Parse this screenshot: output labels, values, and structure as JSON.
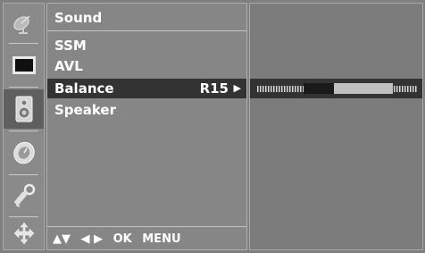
{
  "sidebar": {
    "icons": [
      {
        "name": "satellite-dish-icon",
        "active": false
      },
      {
        "name": "picture-icon",
        "active": false
      },
      {
        "name": "speaker-icon",
        "active": true
      },
      {
        "name": "clock-icon",
        "active": false
      },
      {
        "name": "key-icon",
        "active": false
      },
      {
        "name": "input-source-icon",
        "active": false
      }
    ]
  },
  "menu": {
    "title": "Sound",
    "items": [
      {
        "label": "SSM",
        "value": ""
      },
      {
        "label": "AVL",
        "value": ""
      },
      {
        "label": "Balance",
        "value": "R15",
        "selected": true
      },
      {
        "label": "Speaker",
        "value": ""
      }
    ],
    "nav_hint": {
      "updown": "▲▼",
      "leftright": "◀ ▶",
      "ok": "OK",
      "menu": "MENU"
    }
  },
  "balance": {
    "value_label": "R15",
    "level": 0.65,
    "colors": {
      "left": "#1a1a1a",
      "right": "#c0c0c0",
      "ticks": "#d8d8d8"
    }
  }
}
